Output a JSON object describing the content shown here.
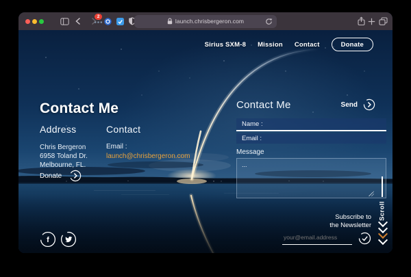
{
  "browser": {
    "url": "launch.chrisbergeron.com",
    "notification_badge": "2"
  },
  "nav": {
    "links": [
      "Sirius SXM-8",
      "Mission",
      "Contact"
    ],
    "donate_label": "Donate"
  },
  "hero": {
    "title": "Contact Me",
    "address_heading": "Address",
    "contact_heading": "Contact",
    "address_lines": [
      "Chris Bergeron",
      "6958 Toland Dr.",
      "Melbourne, FL."
    ],
    "email_label": "Email :",
    "email_link": "launch@chrisbergeron.com",
    "donate_label": "Donate"
  },
  "form": {
    "title": "Contact Me",
    "send_label": "Send",
    "name_placeholder": "Name :",
    "email_placeholder": "Email :",
    "message_label": "Message",
    "message_placeholder": "..."
  },
  "newsletter": {
    "heading_line1": "Subscribe to",
    "heading_line2": "the Newsletter",
    "email_placeholder": "your@email.address"
  },
  "scroll_indicator": {
    "label": "Scroll"
  },
  "colors": {
    "email_link": "#e8a23c",
    "accent_chevron": "#cf7f2e",
    "sky": "#0f3158",
    "titlebar": "#3b343c"
  }
}
